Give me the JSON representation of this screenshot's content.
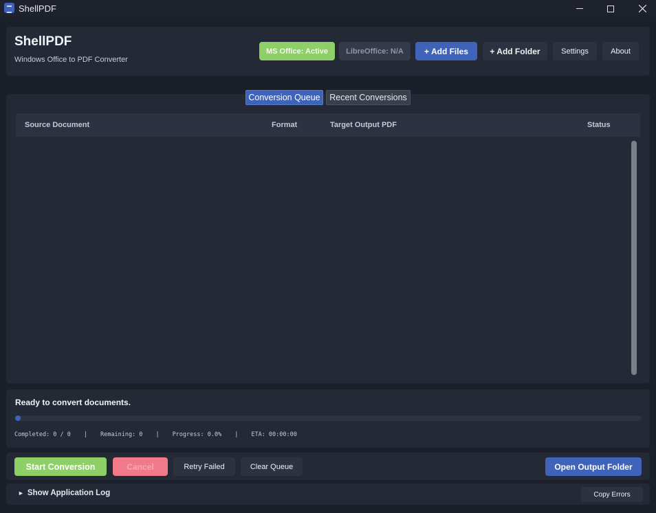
{
  "window": {
    "title": "ShellPDF"
  },
  "header": {
    "app_name": "ShellPDF",
    "subtitle": "Windows Office to PDF Converter",
    "ms_office_status": "MS Office: Active",
    "libreoffice_status": "LibreOffice: N/A",
    "add_files": "+ Add Files",
    "add_folder": "+ Add Folder",
    "settings": "Settings",
    "about": "About"
  },
  "tabs": [
    {
      "label": "Conversion Queue",
      "active": true
    },
    {
      "label": "Recent Conversions",
      "active": false
    }
  ],
  "table": {
    "columns": [
      "Source Document",
      "Format",
      "Target Output PDF",
      "Status"
    ],
    "rows": []
  },
  "progress": {
    "status_text": "Ready to convert documents.",
    "completed": "Completed: 0 / 0",
    "remaining": "Remaining: 0",
    "progress": "Progress: 0.0%",
    "eta": "ETA: 00:00:00",
    "fraction": 0.0
  },
  "actions": {
    "start": "Start Conversion",
    "cancel": "Cancel",
    "retry": "Retry Failed",
    "clear": "Clear Queue",
    "open_output": "Open Output Folder"
  },
  "log": {
    "toggle": "Show Application Log",
    "copy_errors": "Copy Errors"
  },
  "colors": {
    "accent": "#3f63b8",
    "success": "#8fcf68",
    "danger": "#f07a8a",
    "background": "#1b1f29",
    "panel": "#242936"
  }
}
